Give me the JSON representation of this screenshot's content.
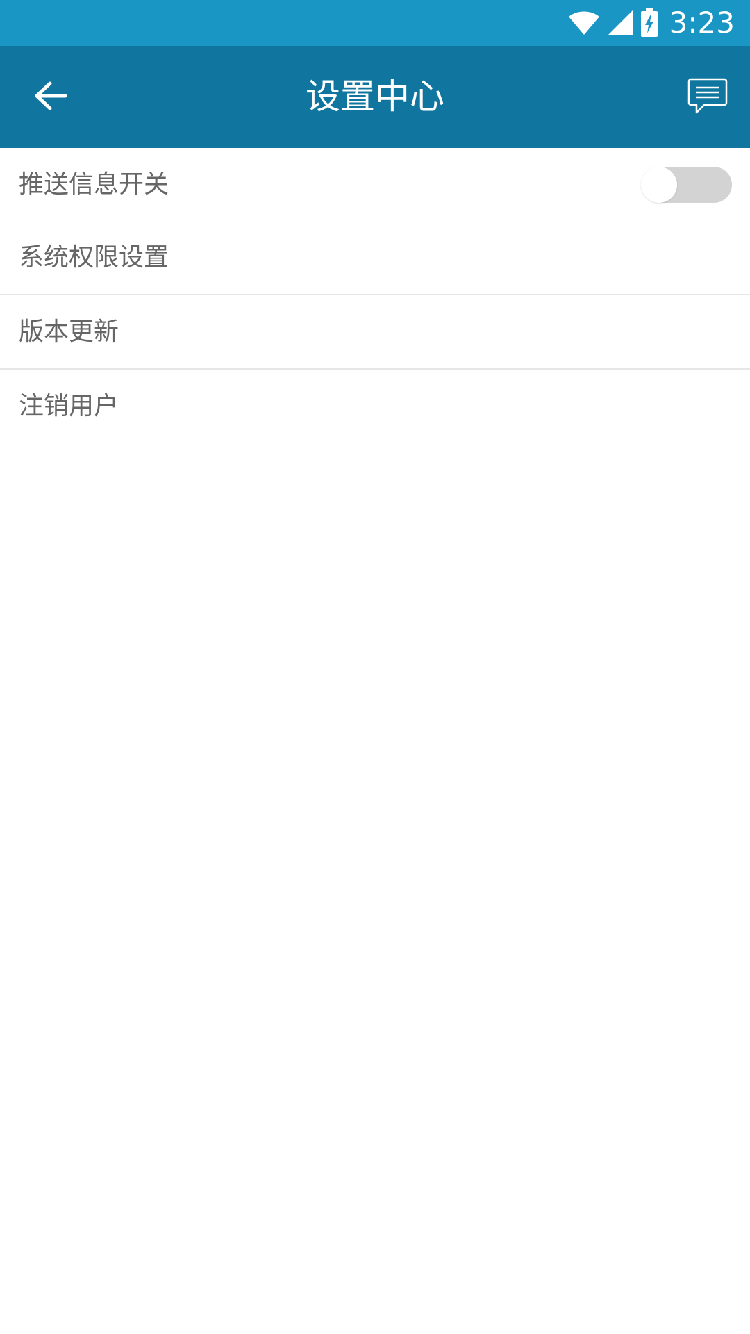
{
  "status_bar": {
    "time": "3:23",
    "icons": [
      "wifi-icon",
      "cell-signal-icon",
      "battery-charging-icon"
    ],
    "color": "#1a96c5"
  },
  "app_bar": {
    "title": "设置中心",
    "back_icon": "back-arrow-icon",
    "action_icon": "message-icon",
    "color": "#10769f"
  },
  "settings": {
    "push_toggle": {
      "label": "推送信息开关",
      "enabled": false
    },
    "items": [
      {
        "label": "系统权限设置"
      },
      {
        "label": "版本更新"
      },
      {
        "label": "注销用户"
      }
    ]
  },
  "colors": {
    "label_text": "#666666",
    "divider": "#e6e6e6",
    "toggle_off": "#d3d3d3"
  }
}
